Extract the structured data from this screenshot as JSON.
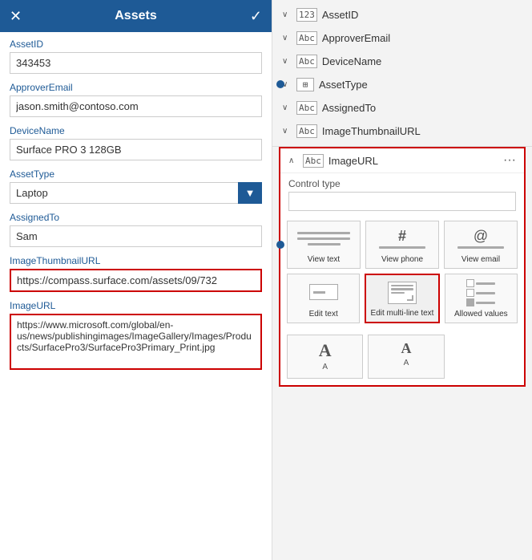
{
  "left": {
    "header": {
      "title": "Assets",
      "close_icon": "✕",
      "check_icon": "✓"
    },
    "fields": [
      {
        "label": "AssetID",
        "value": "343453",
        "type": "text"
      },
      {
        "label": "ApproverEmail",
        "value": "jason.smith@contoso.com",
        "type": "text"
      },
      {
        "label": "DeviceName",
        "value": "Surface PRO 3 128GB",
        "type": "text"
      },
      {
        "label": "AssetType",
        "value": "Laptop",
        "type": "select"
      },
      {
        "label": "AssignedTo",
        "value": "Sam",
        "type": "text"
      },
      {
        "label": "ImageThumbnailURL",
        "value": "https://compass.surface.com/assets/09/732",
        "type": "text",
        "highlighted": true
      },
      {
        "label": "ImageURL",
        "value": "https://www.microsoft.com/global/en-us/news/publishingimages/ImageGallery/Images/Products/SurfacePro3/SurfacePro3Primary_Print.jpg",
        "type": "textarea",
        "highlighted": true
      }
    ]
  },
  "right": {
    "field_list": [
      {
        "name": "AssetID",
        "type_icon": "123",
        "chevron": "∨"
      },
      {
        "name": "ApproverEmail",
        "type_icon": "Abc",
        "chevron": "∨"
      },
      {
        "name": "DeviceName",
        "type_icon": "Abc",
        "chevron": "∨"
      },
      {
        "name": "AssetType",
        "type_icon": "⊞",
        "chevron": "∨"
      },
      {
        "name": "AssignedTo",
        "type_icon": "Abc",
        "chevron": "∨"
      },
      {
        "name": "ImageThumbnailURL",
        "type_icon": "Abc",
        "chevron": "∨"
      }
    ],
    "image_url_section": {
      "title": "ImageURL",
      "type_icon": "Abc",
      "chevron": "∧",
      "dots": "···",
      "control_type_label": "Control type",
      "options_row1": [
        {
          "id": "view-text",
          "label": "View text",
          "selected": false
        },
        {
          "id": "view-phone",
          "label": "View phone",
          "selected": false
        },
        {
          "id": "view-email",
          "label": "View email",
          "selected": false
        }
      ],
      "options_row2": [
        {
          "id": "edit-text",
          "label": "Edit text",
          "selected": false
        },
        {
          "id": "edit-multiline",
          "label": "Edit multi-line\ntext",
          "selected": true
        },
        {
          "id": "allowed-values",
          "label": "Allowed values",
          "selected": false
        }
      ],
      "options_row3": [
        {
          "id": "font-size-1",
          "label": "",
          "selected": false
        },
        {
          "id": "font-size-2",
          "label": "",
          "selected": false
        }
      ]
    }
  }
}
